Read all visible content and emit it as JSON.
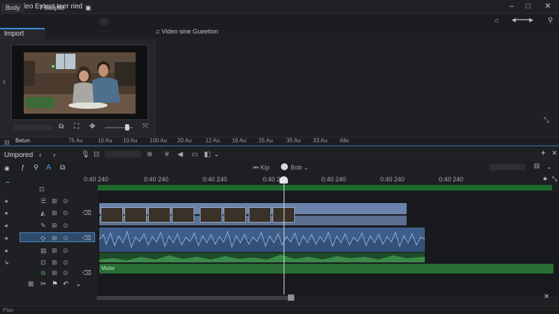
{
  "window": {
    "title": "Video Extent teer ried",
    "btn_min": "–",
    "btn_max": "□",
    "btn_close": "✕"
  },
  "menu": {
    "items": [
      "Body",
      "T baliptie",
      "▣"
    ],
    "right_icons": [
      "◀━━━━▶",
      "⤓"
    ]
  },
  "import_panel": {
    "tab_label": "Import",
    "chev": "‹"
  },
  "source_panel": {
    "tab_label": "♫ Video sine Gueetion"
  },
  "preview_controls": {
    "icons": [
      "⧉",
      "⛶",
      "✥",
      "⤧"
    ]
  },
  "ruler_strip": {
    "labels": [
      "Betun",
      "75 Au",
      "10 Au",
      "10 Au",
      "100 Au",
      "20 Au",
      "12 Au",
      "16 Au",
      "25 Au",
      "35 Au",
      "33 Au",
      "Alle"
    ]
  },
  "timeline_toolbar": {
    "title": "Umpored",
    "chev_left": "‹",
    "icons": [
      "🎙",
      "⊡",
      "⊕",
      "#",
      "◀",
      "▭",
      "◧",
      "⌄"
    ]
  },
  "transport": {
    "prev_label": "Kip",
    "next_label": "Bob"
  },
  "time_ruler": {
    "labels": [
      "0:40 240",
      "0:40 240",
      "0:40 240",
      "0:40 240",
      "0:40 240",
      "0:40 240",
      "0:40 240"
    ]
  },
  "tracks": {
    "audio_label": "Msler",
    "headers": [
      {
        "icons": [
          "◂",
          "⊡"
        ]
      },
      {
        "icons": [
          "◂",
          "☰",
          "⊞",
          "⊙"
        ]
      },
      {
        "icons": [
          "◂",
          "◭",
          "⊞",
          "⊙"
        ]
      },
      {
        "icons": [
          "◂",
          "✎",
          "⊞",
          "⊙"
        ]
      },
      {
        "icons": [
          "◂",
          "◇",
          "⊞",
          "⊙"
        ]
      },
      {
        "icons": [
          "◂",
          "▤",
          "⊞",
          "⊙"
        ]
      },
      {
        "icons": [
          "↳",
          "⊡",
          "⊞",
          "⊙"
        ]
      },
      {
        "icons": [
          "",
          "⊝",
          "⊞",
          "⊙"
        ]
      }
    ]
  },
  "status_bar": {
    "text": "Plav"
  }
}
